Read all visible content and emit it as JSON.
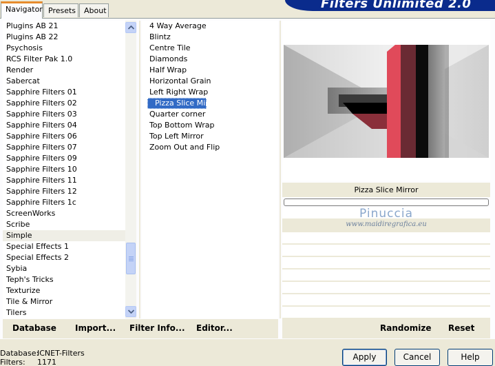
{
  "tabs": [
    {
      "label": "Navigator"
    },
    {
      "label": "Presets"
    },
    {
      "label": "About"
    }
  ],
  "app_title": "Filters Unlimited 2.0",
  "categories": [
    "Plugins AB 21",
    "Plugins AB 22",
    "Psychosis",
    "RCS Filter Pak 1.0",
    "Render",
    "Sabercat",
    "Sapphire Filters 01",
    "Sapphire Filters 02",
    "Sapphire Filters 03",
    "Sapphire Filters 04",
    "Sapphire Filters 06",
    "Sapphire Filters 07",
    "Sapphire Filters 09",
    "Sapphire Filters 10",
    "Sapphire Filters 11",
    "Sapphire Filters 12",
    "Sapphire Filters 1c",
    "ScreenWorks",
    "Scribe",
    "Simple",
    "Special Effects 1",
    "Special Effects 2",
    "Sybia",
    "Teph's Tricks",
    "Texturize",
    "Tile & Mirror",
    "Tilers"
  ],
  "selected_category": "Simple",
  "filters": [
    "4 Way Average",
    "Blintz",
    "Centre Tile",
    "Diamonds",
    "Half Wrap",
    "Horizontal Grain",
    "Left Right Wrap",
    "Pizza Slice Mirror",
    "Quarter corner",
    "Top Bottom Wrap",
    "Top Left Mirror",
    "Zoom Out and Flip"
  ],
  "selected_filter": "Pizza Slice Mirror",
  "preview": {
    "filter_name": "Pizza Slice Mirror"
  },
  "watermark": {
    "name": "Pinuccia",
    "url": "www.maidiregrafica.eu"
  },
  "toolbar_left": {
    "database": "Database",
    "import": "Import...",
    "filter_info": "Filter Info...",
    "editor": "Editor..."
  },
  "toolbar_right": {
    "randomize": "Randomize",
    "reset": "Reset"
  },
  "status": {
    "database_label": "Database:",
    "database_value": "ICNET-Filters",
    "filters_label": "Filters:",
    "filters_value": "1171"
  },
  "buttons": {
    "apply": "Apply",
    "cancel": "Cancel",
    "help": "Help"
  },
  "colors": {
    "accent": "#316ac5",
    "banner": "#0a2b8c",
    "tab_highlight": "#e68b2c",
    "preview_red": "#e04a5a"
  }
}
